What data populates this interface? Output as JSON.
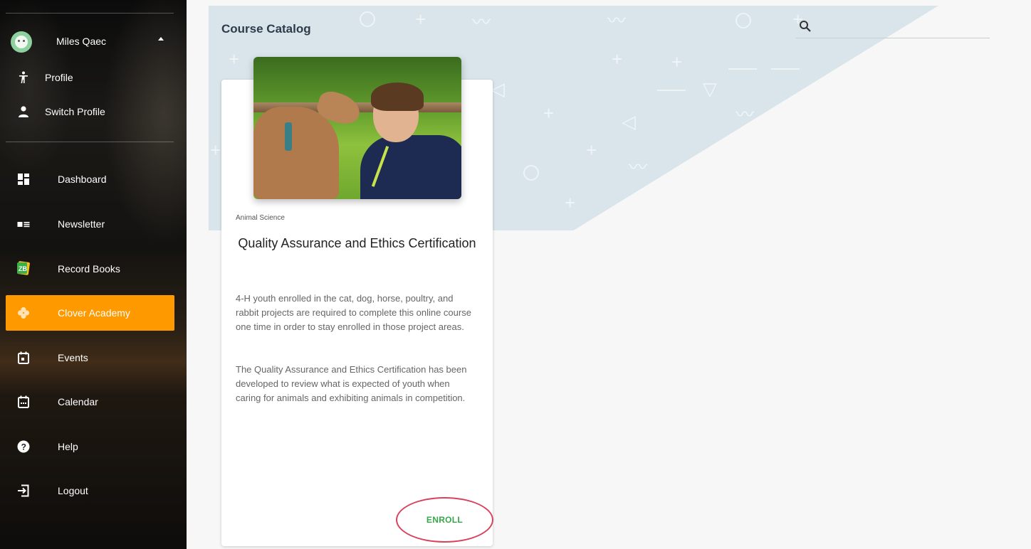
{
  "user": {
    "name": "Miles Qaec"
  },
  "sidebar": {
    "profile_items": [
      {
        "label": "Profile",
        "icon": "person-walking-icon"
      },
      {
        "label": "Switch Profile",
        "icon": "person-icon"
      }
    ],
    "nav_items": [
      {
        "label": "Dashboard",
        "icon": "dashboard-icon",
        "active": false
      },
      {
        "label": "Newsletter",
        "icon": "newsletter-icon",
        "active": false
      },
      {
        "label": "Record Books",
        "icon": "record-books-icon",
        "active": false
      },
      {
        "label": "Clover Academy",
        "icon": "clover-icon",
        "active": true
      },
      {
        "label": "Events",
        "icon": "event-icon",
        "active": false
      },
      {
        "label": "Calendar",
        "icon": "calendar-icon",
        "active": false
      },
      {
        "label": "Help",
        "icon": "help-icon",
        "active": false
      },
      {
        "label": "Logout",
        "icon": "logout-icon",
        "active": false
      }
    ]
  },
  "header": {
    "title": "Course Catalog"
  },
  "search": {
    "placeholder": ""
  },
  "course": {
    "category": "Animal Science",
    "title": "Quality Assurance and Ethics Certification",
    "description_1": "4-H youth enrolled in the cat, dog, horse, poultry, and rabbit projects are required to complete this online course one time in order to stay enrolled in those project areas.",
    "description_2": "The Quality Assurance and Ethics Certification has been developed to review what is expected of youth when caring for animals and exhibiting animals in competition.",
    "enroll_label": "ENROLL"
  },
  "colors": {
    "accent": "#ff9900",
    "banner": "#d9e5ea",
    "enroll_text": "#36a84a",
    "enroll_outline": "#d8435b"
  }
}
